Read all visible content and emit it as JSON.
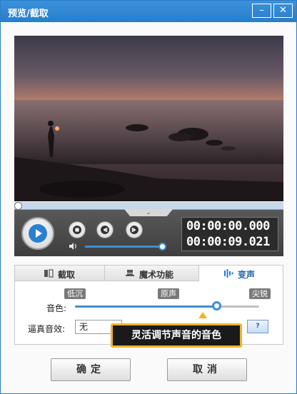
{
  "window": {
    "title": "预览/截取",
    "minimize_glyph": "–",
    "close_glyph": "✕"
  },
  "player": {
    "current_time": "00:00:00.000",
    "total_time": "00:00:09.021",
    "progress_fraction": 0.0,
    "volume_fraction": 0.9,
    "collapse_glyph": "⌄",
    "icons": [
      "play-icon",
      "stop-icon",
      "prev-frame-icon",
      "next-frame-icon",
      "volume-icon"
    ]
  },
  "tabs": [
    {
      "label": "截取",
      "icon": "crop-icon"
    },
    {
      "label": "魔术功能",
      "icon": "magic-hat-icon"
    },
    {
      "label": "变声",
      "icon": "sound-wave-icon"
    }
  ],
  "voice": {
    "pitch_label": "音色:",
    "low_label": "低沉",
    "original_label": "原声",
    "high_label": "尖锐",
    "pitch_fraction": 0.77,
    "effect_label": "逼真音效:",
    "effect_value": "无",
    "help_label": "?"
  },
  "tooltip": "灵活调节声音的音色",
  "buttons": {
    "ok": "确定",
    "cancel": "取消"
  },
  "colors": {
    "titlebar": "#2a7dc8",
    "accent": "#3c8fd8",
    "tooltip_border": "#f3b22b"
  }
}
